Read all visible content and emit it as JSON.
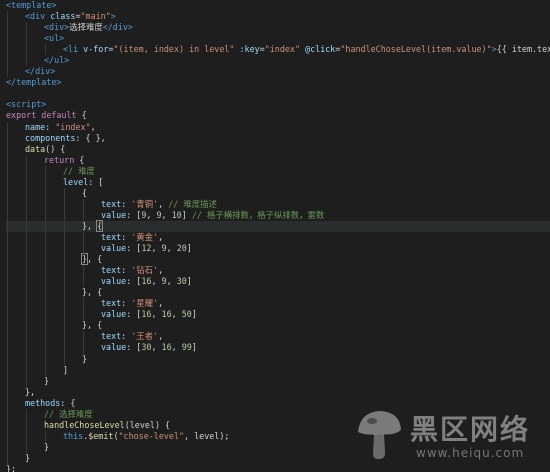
{
  "editor": {
    "lines": [
      {
        "indent": 0,
        "tokens": [
          [
            "tag",
            "<template>"
          ]
        ]
      },
      {
        "indent": 1,
        "tokens": [
          [
            "tag",
            "<div "
          ],
          [
            "attr",
            "class"
          ],
          [
            "plain",
            "="
          ],
          [
            "str",
            "\"main\""
          ],
          [
            "tag",
            ">"
          ]
        ]
      },
      {
        "indent": 2,
        "tokens": [
          [
            "tag",
            "<div>"
          ],
          [
            "plain",
            "选择难度"
          ],
          [
            "tag",
            "</div>"
          ]
        ]
      },
      {
        "indent": 2,
        "tokens": [
          [
            "tag",
            "<ul>"
          ]
        ]
      },
      {
        "indent": 3,
        "tokens": [
          [
            "tag",
            "<li "
          ],
          [
            "attr",
            "v-for"
          ],
          [
            "plain",
            "="
          ],
          [
            "str",
            "\"(item, index) in level\""
          ],
          [
            "plain",
            " "
          ],
          [
            "attr",
            ":key"
          ],
          [
            "plain",
            "="
          ],
          [
            "str",
            "\"index\""
          ],
          [
            "plain",
            " "
          ],
          [
            "attr",
            "@click"
          ],
          [
            "plain",
            "="
          ],
          [
            "str",
            "\"handleChoseLevel(item.value)\""
          ],
          [
            "tag",
            ">"
          ],
          [
            "plain",
            "{{ item.text }}"
          ],
          [
            "tag",
            "</li>"
          ]
        ]
      },
      {
        "indent": 2,
        "tokens": [
          [
            "tag",
            "</ul>"
          ]
        ]
      },
      {
        "indent": 1,
        "tokens": [
          [
            "tag",
            "</div>"
          ]
        ]
      },
      {
        "indent": 0,
        "tokens": [
          [
            "tag",
            "</template>"
          ]
        ]
      },
      {
        "indent": 0,
        "tokens": []
      },
      {
        "indent": 0,
        "tokens": [
          [
            "tag",
            "<script>"
          ]
        ]
      },
      {
        "indent": 0,
        "tokens": [
          [
            "kw",
            "export default"
          ],
          [
            "plain",
            " {"
          ]
        ]
      },
      {
        "indent": 1,
        "tokens": [
          [
            "prop",
            "name"
          ],
          [
            "plain",
            ": "
          ],
          [
            "str",
            "\"index\""
          ],
          [
            "plain",
            ","
          ]
        ]
      },
      {
        "indent": 1,
        "tokens": [
          [
            "prop",
            "components"
          ],
          [
            "plain",
            ": { },"
          ]
        ]
      },
      {
        "indent": 1,
        "tokens": [
          [
            "fn",
            "data"
          ],
          [
            "plain",
            "() {"
          ]
        ]
      },
      {
        "indent": 2,
        "tokens": [
          [
            "kw",
            "return"
          ],
          [
            "plain",
            " {"
          ]
        ]
      },
      {
        "indent": 3,
        "tokens": [
          [
            "com",
            "// 难度"
          ]
        ]
      },
      {
        "indent": 3,
        "tokens": [
          [
            "prop",
            "level"
          ],
          [
            "plain",
            ": ["
          ]
        ]
      },
      {
        "indent": 4,
        "tokens": [
          [
            "plain",
            "{"
          ]
        ]
      },
      {
        "indent": 5,
        "tokens": [
          [
            "prop",
            "text"
          ],
          [
            "plain",
            ": "
          ],
          [
            "str",
            "'青铜'"
          ],
          [
            "plain",
            ", "
          ],
          [
            "com",
            "// 难度描述"
          ]
        ]
      },
      {
        "indent": 5,
        "tokens": [
          [
            "prop",
            "value"
          ],
          [
            "plain",
            ": ["
          ],
          [
            "num",
            "9"
          ],
          [
            "plain",
            ", "
          ],
          [
            "num",
            "9"
          ],
          [
            "plain",
            ", "
          ],
          [
            "num",
            "10"
          ],
          [
            "plain",
            "] "
          ],
          [
            "com",
            "// 格子横排数，格子纵排数，雷数"
          ]
        ]
      },
      {
        "indent": 4,
        "tokens": [
          [
            "plain",
            "}, "
          ],
          [
            "brhl",
            "{"
          ]
        ],
        "selected": true
      },
      {
        "indent": 5,
        "tokens": [
          [
            "prop",
            "text"
          ],
          [
            "plain",
            ": "
          ],
          [
            "str",
            "'黄金'"
          ],
          [
            "plain",
            ","
          ]
        ]
      },
      {
        "indent": 5,
        "tokens": [
          [
            "prop",
            "value"
          ],
          [
            "plain",
            ": ["
          ],
          [
            "num",
            "12"
          ],
          [
            "plain",
            ", "
          ],
          [
            "num",
            "9"
          ],
          [
            "plain",
            ", "
          ],
          [
            "num",
            "20"
          ],
          [
            "plain",
            "]"
          ]
        ]
      },
      {
        "indent": 4,
        "tokens": [
          [
            "brhl",
            "}"
          ],
          [
            "plain",
            ", {"
          ]
        ]
      },
      {
        "indent": 5,
        "tokens": [
          [
            "prop",
            "text"
          ],
          [
            "plain",
            ": "
          ],
          [
            "str",
            "'钻石'"
          ],
          [
            "plain",
            ","
          ]
        ]
      },
      {
        "indent": 5,
        "tokens": [
          [
            "prop",
            "value"
          ],
          [
            "plain",
            ": ["
          ],
          [
            "num",
            "16"
          ],
          [
            "plain",
            ", "
          ],
          [
            "num",
            "9"
          ],
          [
            "plain",
            ", "
          ],
          [
            "num",
            "30"
          ],
          [
            "plain",
            "]"
          ]
        ]
      },
      {
        "indent": 4,
        "tokens": [
          [
            "plain",
            "}, {"
          ]
        ]
      },
      {
        "indent": 5,
        "tokens": [
          [
            "prop",
            "text"
          ],
          [
            "plain",
            ": "
          ],
          [
            "str",
            "'星耀'"
          ],
          [
            "plain",
            ","
          ]
        ]
      },
      {
        "indent": 5,
        "tokens": [
          [
            "prop",
            "value"
          ],
          [
            "plain",
            ": ["
          ],
          [
            "num",
            "16"
          ],
          [
            "plain",
            ", "
          ],
          [
            "num",
            "16"
          ],
          [
            "plain",
            ", "
          ],
          [
            "num",
            "50"
          ],
          [
            "plain",
            "]"
          ]
        ]
      },
      {
        "indent": 4,
        "tokens": [
          [
            "plain",
            "}, {"
          ]
        ]
      },
      {
        "indent": 5,
        "tokens": [
          [
            "prop",
            "text"
          ],
          [
            "plain",
            ": "
          ],
          [
            "str",
            "'王者'"
          ],
          [
            "plain",
            ","
          ]
        ]
      },
      {
        "indent": 5,
        "tokens": [
          [
            "prop",
            "value"
          ],
          [
            "plain",
            ": ["
          ],
          [
            "num",
            "30"
          ],
          [
            "plain",
            ", "
          ],
          [
            "num",
            "16"
          ],
          [
            "plain",
            ", "
          ],
          [
            "num",
            "99"
          ],
          [
            "plain",
            "]"
          ]
        ]
      },
      {
        "indent": 4,
        "tokens": [
          [
            "plain",
            "}"
          ]
        ]
      },
      {
        "indent": 3,
        "tokens": [
          [
            "plain",
            "]"
          ]
        ]
      },
      {
        "indent": 2,
        "tokens": [
          [
            "plain",
            "}"
          ]
        ]
      },
      {
        "indent": 1,
        "tokens": [
          [
            "plain",
            "},"
          ]
        ]
      },
      {
        "indent": 1,
        "tokens": [
          [
            "prop",
            "methods"
          ],
          [
            "plain",
            ": {"
          ]
        ]
      },
      {
        "indent": 2,
        "tokens": [
          [
            "com",
            "// 选择难度"
          ]
        ]
      },
      {
        "indent": 2,
        "tokens": [
          [
            "fn",
            "handleChoseLevel"
          ],
          [
            "plain",
            "(level) {"
          ]
        ]
      },
      {
        "indent": 3,
        "tokens": [
          [
            "key",
            "this"
          ],
          [
            "plain",
            "."
          ],
          [
            "fn",
            "$emit"
          ],
          [
            "plain",
            "("
          ],
          [
            "str",
            "\"chose-level\""
          ],
          [
            "plain",
            ", level);"
          ]
        ]
      },
      {
        "indent": 2,
        "tokens": [
          [
            "plain",
            "}"
          ]
        ]
      },
      {
        "indent": 1,
        "tokens": [
          [
            "plain",
            "}"
          ]
        ]
      },
      {
        "indent": 0,
        "tokens": [
          [
            "plain",
            "};"
          ]
        ]
      }
    ]
  },
  "watermark": {
    "title": "黑区网络",
    "url": "www.heiqu.com",
    "icon": "mushroom-logo-icon"
  },
  "colors": {
    "background": "#1e1e1e",
    "tag": "#569cd6",
    "attribute": "#9cdcfe",
    "string": "#ce9178",
    "keyword": "#c586c0",
    "function": "#dcdcaa",
    "number": "#b5cea8",
    "comment": "#6a9955"
  }
}
